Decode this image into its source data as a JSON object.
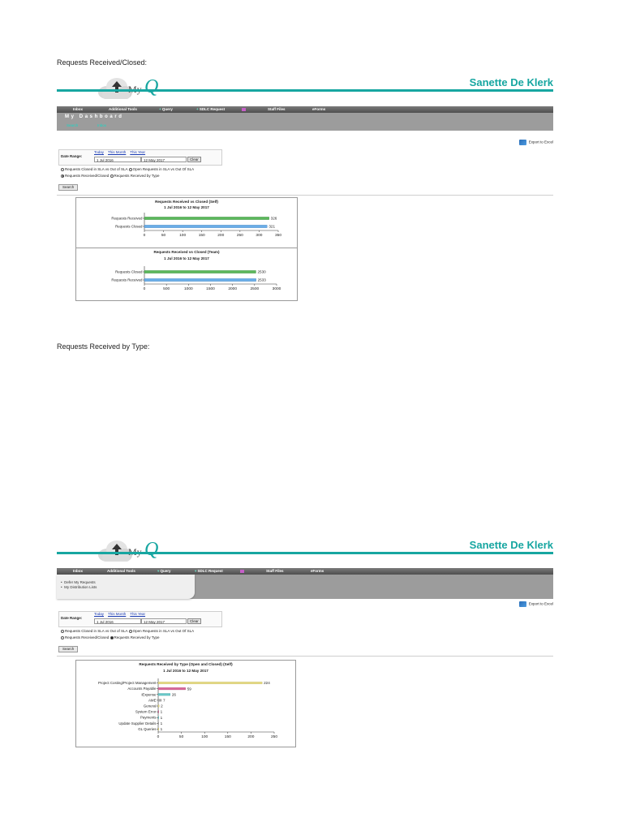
{
  "sections": {
    "received_closed_heading": "Requests Received/Closed:",
    "by_type_heading": "Requests Received by Type:"
  },
  "app": {
    "logo_my": "My",
    "logo_q": "Q",
    "user_name": "Sanette De Klerk",
    "nav": {
      "inbox": "Inbox",
      "additional_tools": "Additional Tools",
      "query": "Query",
      "sdlc_request": "SDLC Request",
      "staff_files": "Staff Files",
      "eforms": "eForms"
    },
    "dashboard_title": "My Dashboard",
    "subnav": [
      "Search",
      "Inbox"
    ],
    "dropdown_items": [
      "Defer My Requests",
      "My Distribution Lists"
    ],
    "export_label": "Export to Excel",
    "filters": {
      "date_range_label": "Date Range:",
      "quick_links": [
        "Today",
        "This Month",
        "This Year"
      ],
      "from_date": "1 Jul 2016",
      "to_date": "12 May 2017",
      "clear_label": "Clear",
      "radio_options": [
        "Requests Closed in SLA vs Out of SLA",
        "Open Requests in SLA vs Out Of SLA",
        "Requests Received/Closed",
        "Requests Received by Type"
      ],
      "search_label": "Search"
    }
  },
  "colors": {
    "brand": "#17a6a1",
    "received_bar": "#5cb85c",
    "closed_bar": "#6aaee8",
    "type_bar_1": "#e8dd8a",
    "type_bar_2": "#d9699a",
    "type_bar_3": "#6ac9c9"
  },
  "chart_data": [
    {
      "type": "bar",
      "orientation": "horizontal",
      "title": "Requests Received vs Closed (Self)",
      "subtitle": "1 Jul 2016 to 12 May 2017",
      "categories": [
        "Requests Received",
        "Requests Closed"
      ],
      "values": [
        326,
        321
      ],
      "data_labels": [
        "326",
        "321"
      ],
      "xlim": [
        0,
        350
      ],
      "xticks": [
        0,
        50,
        100,
        150,
        200,
        250,
        300,
        350
      ]
    },
    {
      "type": "bar",
      "orientation": "horizontal",
      "title": "Requests Received vs Closed (Team)",
      "subtitle": "1 Jul 2016 to 12 May 2017",
      "categories": [
        "Requests Closed",
        "Requests Received"
      ],
      "values": [
        2530,
        2533
      ],
      "data_labels": [
        "2530",
        "2533"
      ],
      "xlim": [
        0,
        3000
      ],
      "xticks": [
        0,
        500,
        1000,
        1500,
        2000,
        2500,
        3000
      ]
    },
    {
      "type": "bar",
      "orientation": "horizontal",
      "title": "Requests Received by Type (Open and Closed) (Self)",
      "subtitle": "1 Jul 2016 to 12 May 2017",
      "categories": [
        "Project Costing/Project Management",
        "Accounts Payable",
        "iExpense",
        "AME",
        "General",
        "System Error",
        "Payments",
        "Update Supplier Details",
        "GL Queries"
      ],
      "values": [
        224,
        59,
        26,
        7,
        2,
        1,
        1,
        1,
        1
      ],
      "data_labels": [
        "224",
        "59",
        "26",
        "7",
        "2",
        "1",
        "1",
        "1",
        "1"
      ],
      "xlim": [
        0,
        250
      ],
      "xticks": [
        0,
        50,
        100,
        150,
        200,
        250
      ]
    }
  ]
}
